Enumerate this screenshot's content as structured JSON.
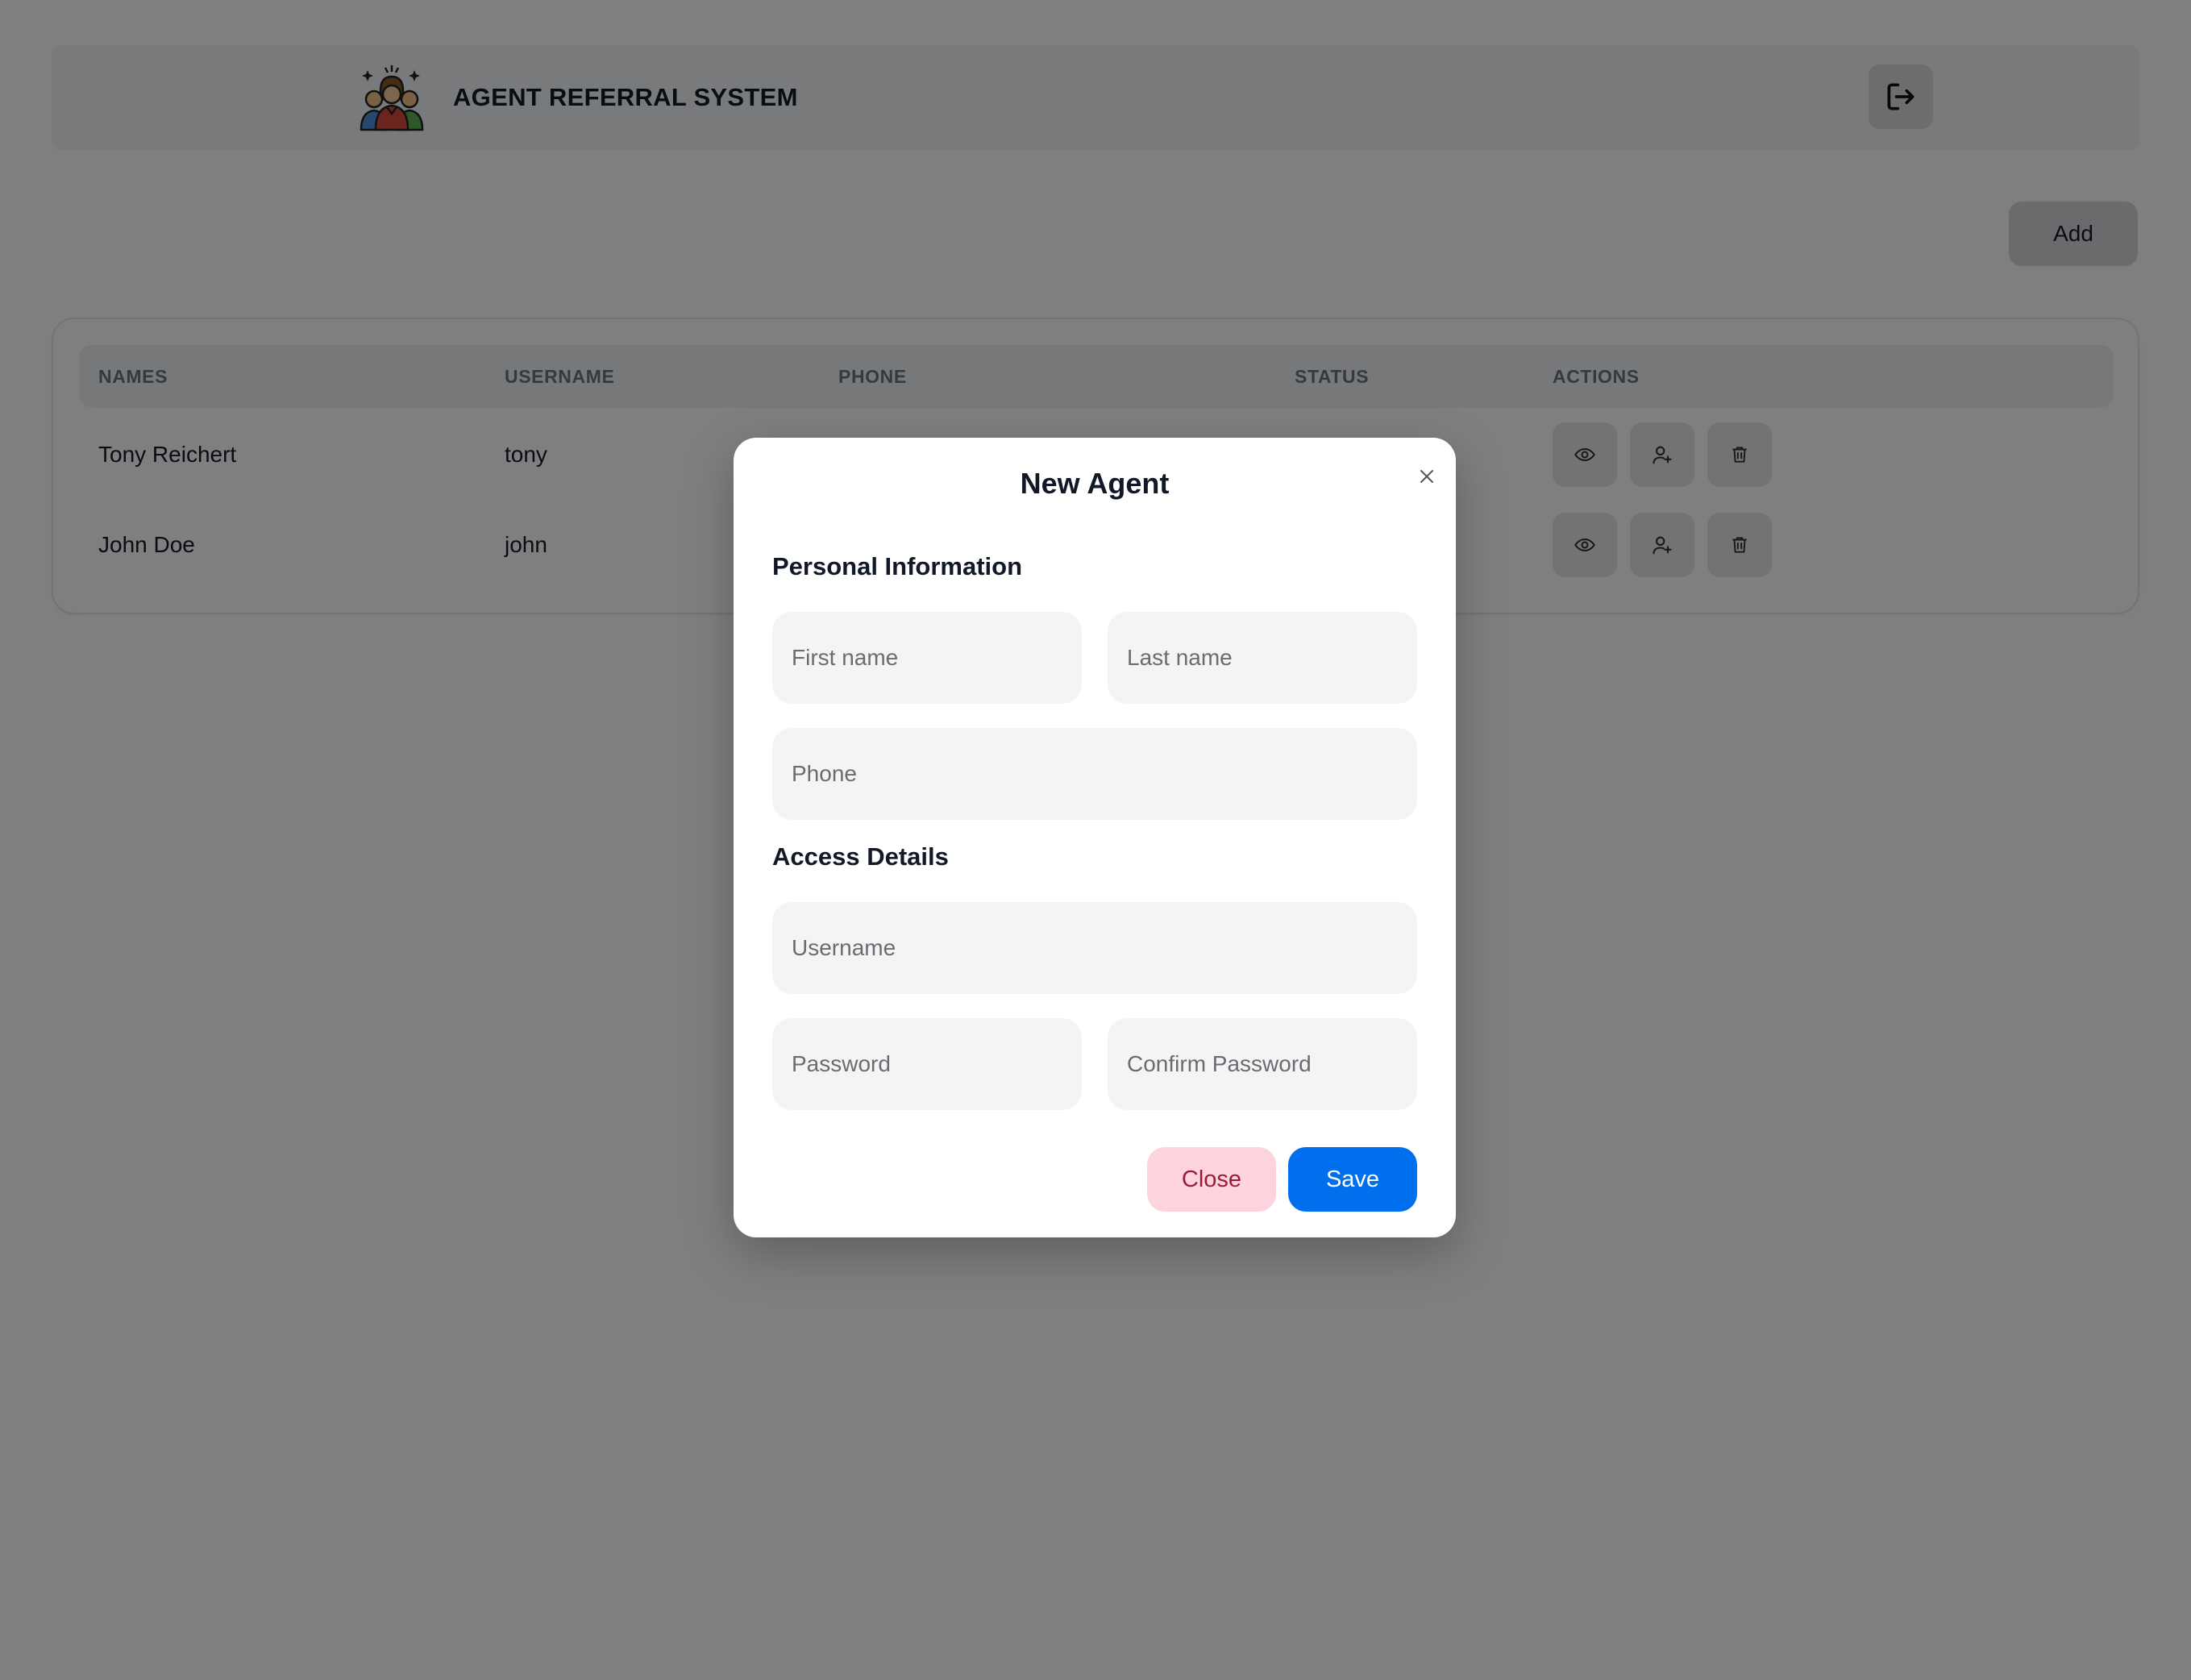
{
  "header": {
    "title": "AGENT REFERRAL SYSTEM",
    "logo_icon": "agents-group-icon",
    "logout_icon": "logout-icon"
  },
  "toolbar": {
    "add_label": "Add"
  },
  "table": {
    "columns": [
      "NAMES",
      "USERNAME",
      "PHONE",
      "STATUS",
      "ACTIONS"
    ],
    "rows": [
      {
        "name": "Tony Reichert",
        "username": "tony",
        "phone": "",
        "status": ""
      },
      {
        "name": "John Doe",
        "username": "john",
        "phone": "",
        "status": ""
      }
    ],
    "action_icons": [
      "eye-icon",
      "user-plus-icon",
      "trash-icon"
    ]
  },
  "modal": {
    "title": "New Agent",
    "close_icon": "close-icon",
    "personal_section": "Personal Information",
    "access_section": "Access Details",
    "fields": {
      "first_name": {
        "placeholder": "First name",
        "value": ""
      },
      "last_name": {
        "placeholder": "Last name",
        "value": ""
      },
      "phone": {
        "placeholder": "Phone",
        "value": ""
      },
      "username": {
        "placeholder": "Username",
        "value": ""
      },
      "password": {
        "placeholder": "Password",
        "value": ""
      },
      "confirm_password": {
        "placeholder": "Confirm Password",
        "value": ""
      }
    },
    "close_label": "Close",
    "save_label": "Save"
  },
  "colors": {
    "overlay": "#000000",
    "primary": "#006fee",
    "danger_soft": "#fdd4de",
    "danger_text": "#9b1c3a"
  }
}
